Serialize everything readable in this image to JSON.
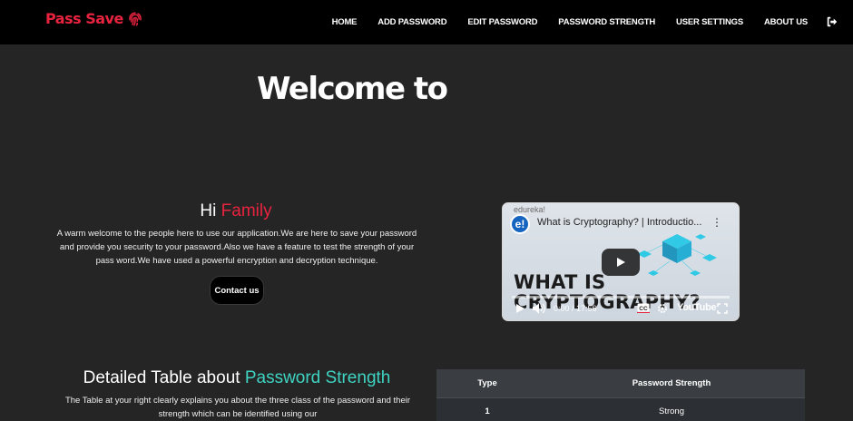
{
  "navbar": {
    "brand": "Pass Save",
    "brand_icon": "fingerprint-icon",
    "links": [
      {
        "label": "HOME"
      },
      {
        "label": "ADD PASSWORD"
      },
      {
        "label": "EDIT PASSWORD"
      },
      {
        "label": "PASSWORD STRENGTH"
      },
      {
        "label": "USER SETTINGS"
      },
      {
        "label": "ABOUT US"
      }
    ],
    "logout_icon": "sign-out-icon"
  },
  "hero": {
    "title": "Welcome to"
  },
  "greeting": {
    "prefix": "Hi",
    "name": "Family",
    "text": "A warm welcome to the people here to use our application.We are here to save your password and provide you security to your password.Also we have a feature to test the strength of your pass word.We have used a powerful encryption and decryption technique.",
    "contact_label": "Contact us"
  },
  "video": {
    "channel": "edureka!",
    "logo_text": "e!",
    "title": "What is Cryptography? | Introductio...",
    "big_text": "WHAT IS CRYPTOGRAPHY?",
    "time": "0:00 / 17:56",
    "youtube_label": "YouTube",
    "icons": [
      "play-icon",
      "volume-icon",
      "cc-icon",
      "settings-icon",
      "fullscreen-icon",
      "more-icon"
    ]
  },
  "detail": {
    "title_prefix": "Detailed Table about",
    "title_highlight": "Password Strength",
    "text": "The Table at your right clearly explains you about the three class of the password and their strength which can be identified using our"
  },
  "table": {
    "headers": [
      "Type",
      "Password Strength"
    ],
    "rows": [
      {
        "type": "1",
        "strength": "Strong"
      }
    ]
  },
  "colors": {
    "accent_red": "#e8233f",
    "accent_teal": "#3fd3c1",
    "background": "#252526",
    "navbar": "#000000"
  }
}
